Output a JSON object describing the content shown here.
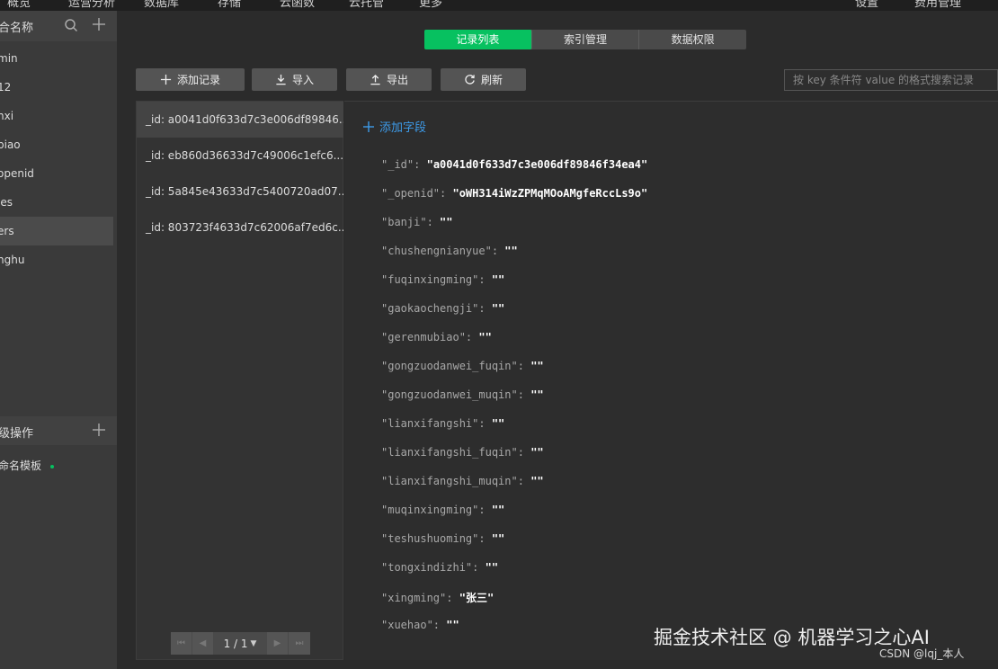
{
  "topnav": [
    "概览",
    "运营分析",
    "数据库",
    "存储",
    "云函数",
    "云托管",
    "更多",
    "设置",
    "费用管理"
  ],
  "sidebar": {
    "title": "合名称",
    "items": [
      "min",
      "12",
      "nxi",
      "biao",
      "openid",
      "les",
      "ers",
      "nghu"
    ],
    "active_index": 6,
    "section2_title": "级操作",
    "template_label": "命名模板"
  },
  "tabs": [
    {
      "label": "记录列表",
      "active": true
    },
    {
      "label": "索引管理",
      "active": false
    },
    {
      "label": "数据权限",
      "active": false
    }
  ],
  "toolbar": {
    "add_label": "添加记录",
    "import_label": "导入",
    "export_label": "导出",
    "refresh_label": "刷新",
    "search_placeholder": "按 key 条件符 value 的格式搜索记录"
  },
  "records": [
    "_id: a0041d0f633d7c3e006df89846...",
    "_id: eb860d36633d7c49006c1efc6...",
    "_id: 5a845e43633d7c5400720ad07...",
    "_id: 803723f4633d7c62006af7ed6c..."
  ],
  "records_active_index": 0,
  "pager": {
    "label": "1 / 1"
  },
  "document": {
    "add_field_label": "添加字段",
    "fields": [
      {
        "key": "\"_id\":",
        "value": "\"a0041d0f633d7c3e006df89846f34ea4\""
      },
      {
        "key": "\"_openid\":",
        "value": "\"oWH314iWzZPMqMOoAMgfeRccLs9o\""
      },
      {
        "key": "\"banji\":",
        "value": "\"\""
      },
      {
        "key": "\"chushengnianyue\":",
        "value": "\"\""
      },
      {
        "key": "\"fuqinxingming\":",
        "value": "\"\""
      },
      {
        "key": "\"gaokaochengji\":",
        "value": "\"\""
      },
      {
        "key": "\"gerenmubiao\":",
        "value": "\"\""
      },
      {
        "key": "\"gongzuodanwei_fuqin\":",
        "value": "\"\""
      },
      {
        "key": "\"gongzuodanwei_muqin\":",
        "value": "\"\""
      },
      {
        "key": "\"lianxifangshi\":",
        "value": "\"\""
      },
      {
        "key": "\"lianxifangshi_fuqin\":",
        "value": "\"\""
      },
      {
        "key": "\"lianxifangshi_muqin\":",
        "value": "\"\""
      },
      {
        "key": "\"muqinxingming\":",
        "value": "\"\""
      },
      {
        "key": "\"teshushuoming\":",
        "value": "\"\""
      },
      {
        "key": "\"tongxindizhi\":",
        "value": "\"\""
      },
      {
        "key": "\"xingming\":",
        "value": "\"张三\""
      },
      {
        "key": "\"xuehao\":",
        "value": "\"\""
      }
    ]
  },
  "watermark": "掘金技术社区 @ 机器学习之心AI",
  "csdn_mark": "CSDN @lqj_本人",
  "colors": {
    "accent": "#07c160",
    "link": "#3d9be9"
  }
}
